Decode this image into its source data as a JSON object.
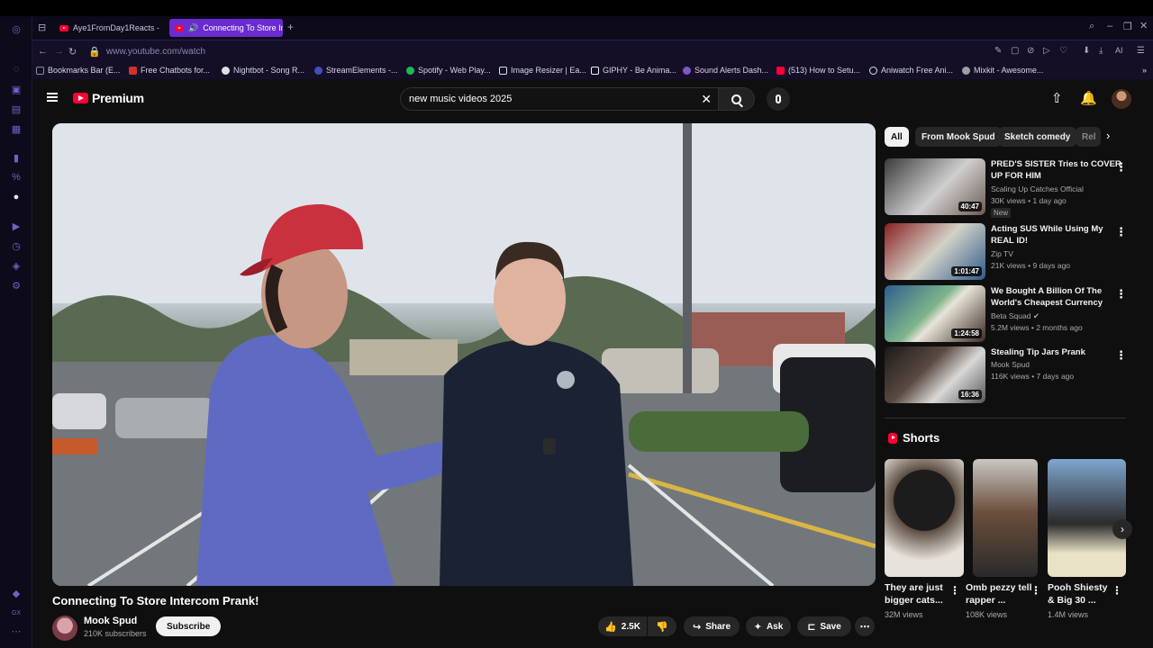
{
  "browser": {
    "tabs": [
      {
        "label": "Aye1FromDay1Reacts - Yo"
      },
      {
        "label": "Connecting To Store In"
      }
    ],
    "url": "www.youtube.com/watch",
    "bookmarks": [
      {
        "label": "Bookmarks Bar (E...",
        "color": "#8a8aa0"
      },
      {
        "label": "Free Chatbots for...",
        "color": "#d32f2f"
      },
      {
        "label": "Nightbot - Song R...",
        "color": "#e0e0e0"
      },
      {
        "label": "StreamElements -...",
        "color": "#3f51b5"
      },
      {
        "label": "Spotify - Web Play...",
        "color": "#1db954"
      },
      {
        "label": "Image Resizer | Ea...",
        "color": "#e0e0e0"
      },
      {
        "label": "GIPHY - Be Anima...",
        "color": "#f0f0f0"
      },
      {
        "label": "Sound Alerts Dash...",
        "color": "#7e57c2"
      },
      {
        "label": "(513) How to Setu...",
        "color": "#ff0033"
      },
      {
        "label": "Aniwatch Free Ani...",
        "color": "#e0e0e0"
      },
      {
        "label": "Mixkit - Awesome...",
        "color": "#9e9e9e"
      }
    ]
  },
  "header": {
    "logo_text": "Premium",
    "search_value": "new music videos 2025"
  },
  "video": {
    "title": "Connecting To Store Intercom Prank!",
    "channel": "Mook Spud",
    "subscribers": "210K subscribers",
    "subscribe_label": "Subscribe",
    "likes": "2.5K",
    "share_label": "Share",
    "ask_label": "Ask",
    "save_label": "Save"
  },
  "chips": [
    "All",
    "From Mook Spud",
    "Sketch comedy",
    "Rel"
  ],
  "recommendations": [
    {
      "title": "PRED'S SISTER Tries to COVER UP FOR HIM",
      "channel": "Scaling Up Catches Official",
      "meta": "30K views • 1 day ago",
      "badge": "New",
      "duration": "40:47"
    },
    {
      "title": "Acting SUS While Using My REAL ID!",
      "channel": "Zip TV",
      "meta": "21K views • 9 days ago",
      "duration": "1:01:47"
    },
    {
      "title": "We Bought A Billion Of The World's Cheapest Currency",
      "channel": "Beta Squad",
      "meta": "5.2M views • 2 months ago",
      "duration": "1:24:58"
    },
    {
      "title": "Stealing Tip Jars Prank",
      "channel": "Mook Spud",
      "meta": "116K views • 7 days ago",
      "duration": "16:36"
    }
  ],
  "shorts": {
    "heading": "Shorts",
    "items": [
      {
        "title": "They are just bigger cats...",
        "views": "32M views"
      },
      {
        "title": "Omb pezzy tell rapper ...",
        "views": "108K views"
      },
      {
        "title": "Pooh Shiesty & Big 30 ...",
        "views": "1.4M views"
      }
    ]
  },
  "colors": {
    "accent_tab": "#6a2bd0",
    "youtube_red": "#ff0033",
    "background": "#0f0f0f"
  }
}
